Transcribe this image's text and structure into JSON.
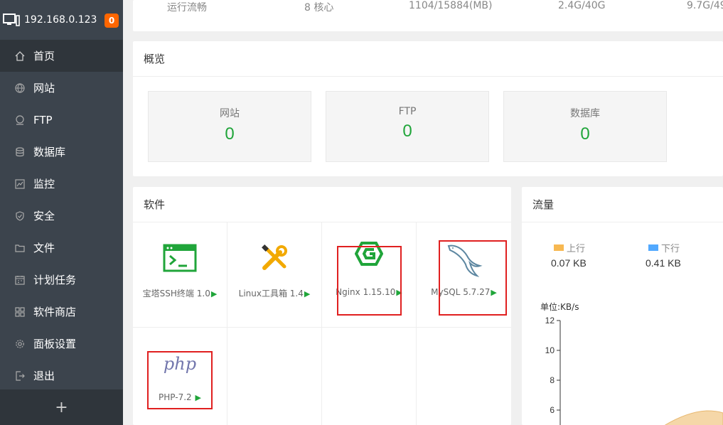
{
  "sidebar": {
    "host": "192.168.0.123",
    "badge": "0",
    "items": [
      {
        "label": "首页",
        "icon": "home-icon",
        "active": true
      },
      {
        "label": "网站",
        "icon": "globe-icon"
      },
      {
        "label": "FTP",
        "icon": "ftp-icon"
      },
      {
        "label": "数据库",
        "icon": "database-icon"
      },
      {
        "label": "监控",
        "icon": "monitor-icon"
      },
      {
        "label": "安全",
        "icon": "shield-icon"
      },
      {
        "label": "文件",
        "icon": "folder-icon"
      },
      {
        "label": "计划任务",
        "icon": "calendar-icon"
      },
      {
        "label": "软件商店",
        "icon": "grid-icon"
      },
      {
        "label": "面板设置",
        "icon": "gear-icon"
      },
      {
        "label": "退出",
        "icon": "logout-icon"
      }
    ],
    "add": "+"
  },
  "top_strip": {
    "col1": "运行流畅",
    "col2": "8 核心",
    "col3": "1104/15884(MB)",
    "col4": "2.4G/40G",
    "col5": "9.7G/49"
  },
  "overview": {
    "title": "概览",
    "cards": [
      {
        "label": "网站",
        "value": "0"
      },
      {
        "label": "FTP",
        "value": "0"
      },
      {
        "label": "数据库",
        "value": "0"
      }
    ]
  },
  "software": {
    "title": "软件",
    "items": [
      {
        "name": "宝塔SSH终端 1.0",
        "icon": "terminal-icon"
      },
      {
        "name": "Linux工具箱 1.4",
        "icon": "tools-icon"
      },
      {
        "name": "Nginx 1.15.10",
        "icon": "nginx-icon"
      },
      {
        "name": "MySQL 5.7.27",
        "icon": "mysql-dolphin-icon"
      },
      {
        "name": "PHP-7.2",
        "icon": "php-icon"
      }
    ]
  },
  "traffic": {
    "title": "流量",
    "up_label": "上行",
    "down_label": "下行",
    "up_value": "0.07 KB",
    "down_value": "0.41 KB",
    "unit": "单位:KB/s",
    "colors": {
      "up": "#f7b851",
      "down": "#52a9ff"
    },
    "chart_data": {
      "type": "area",
      "ylabel": "单位:KB/s",
      "y_ticks": [
        12,
        10,
        8,
        6
      ]
    }
  },
  "colors": {
    "accent": "#20a53a",
    "sidebar": "#3c444d",
    "badge": "#ff6600",
    "highlight": "#e02020"
  }
}
